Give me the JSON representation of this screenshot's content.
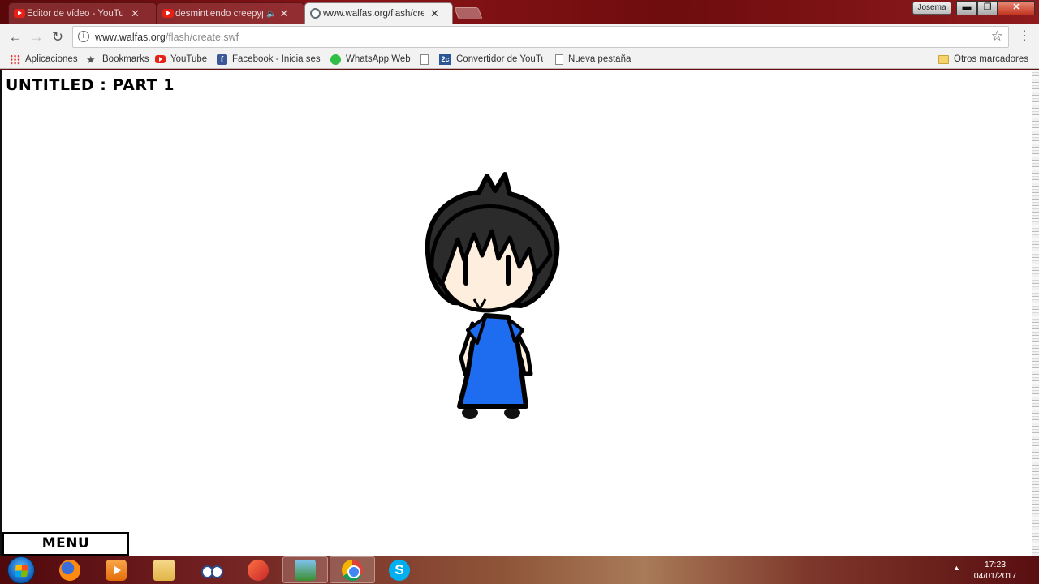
{
  "browser": {
    "tabs": [
      {
        "title": "Editor de vídeo - YouTube",
        "favicon": "youtube-icon",
        "active": false,
        "audio": false
      },
      {
        "title": "desmintiendo creepypastas",
        "favicon": "youtube-icon",
        "active": false,
        "audio": true
      },
      {
        "title": "www.walfas.org/flash/create.swf",
        "favicon": "globe-icon",
        "active": true,
        "audio": false
      }
    ],
    "tab_close_glyph": "✕",
    "audio_glyph": "🔈",
    "user_name": "Josema",
    "window_buttons": {
      "minimize": "▬",
      "maximize": "❐",
      "close": "✕"
    },
    "nav": {
      "back": "←",
      "forward": "→",
      "reload": "↻"
    },
    "address": {
      "host": "www.walfas.org",
      "path": "/flash/create.swf",
      "info_glyph": "i",
      "bookmark_glyph": "☆"
    },
    "menu_glyph": "⋮",
    "bookmarks": [
      {
        "label": "Aplicaciones",
        "icon": "apps-grid-icon"
      },
      {
        "label": "Bookmarks",
        "icon": "star-icon"
      },
      {
        "label": "YouTube",
        "icon": "youtube-icon"
      },
      {
        "label": "Facebook - Inicia sesión",
        "icon": "facebook-icon"
      },
      {
        "label": "WhatsApp Web",
        "icon": "whatsapp-icon"
      },
      {
        "label": "",
        "icon": "page-icon"
      },
      {
        "label": "Convertidor de YouTube",
        "icon": "2c-icon"
      },
      {
        "label": "Nueva pestaña",
        "icon": "page-icon"
      }
    ],
    "other_bookmarks": "Otros marcadores"
  },
  "page": {
    "stage_title": "UNTITLED : PART 1",
    "menu_button": "MENU",
    "character": {
      "hair_color": "#2b2b2b",
      "skin_color": "#fdeedd",
      "shirt_color": "#1e6cf0",
      "outline_color": "#000000"
    }
  },
  "taskbar": {
    "apps": [
      "start-orb-icon",
      "firefox-icon",
      "media-player-icon",
      "file-explorer-icon",
      "eyes-app-icon",
      "tool-app-icon",
      "network-app-icon",
      "chrome-icon",
      "skype-icon"
    ],
    "active_app": "chrome-icon",
    "time": "17:23",
    "date": "04/01/2017",
    "tray_arrow": "▲"
  },
  "colors": {
    "accent_titlebar": "#7a1013",
    "toolbar_bg": "#f2f2f2",
    "page_bg": "#ffffff"
  }
}
